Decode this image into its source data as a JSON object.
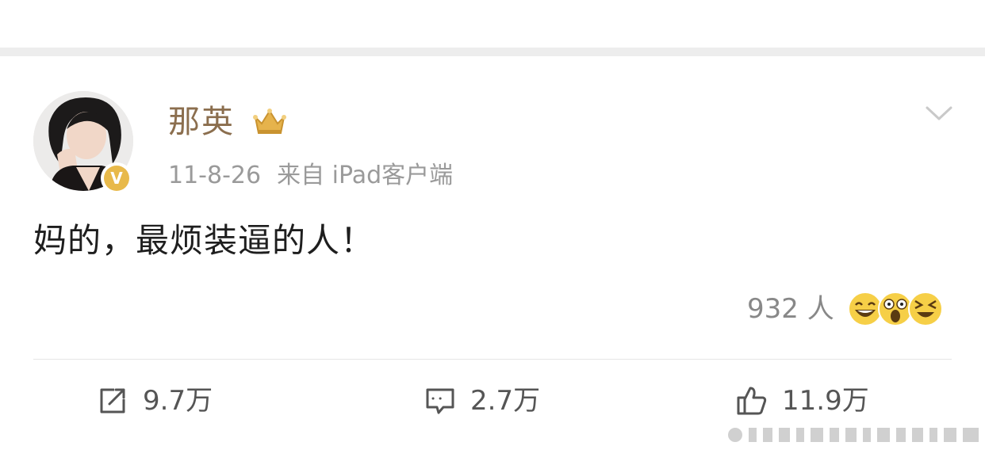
{
  "post": {
    "username": "那英",
    "date": "11-8-26",
    "source": "来自 iPad客户端",
    "text": "妈的，最烦装逼的人！",
    "reactions": {
      "count_label": "932 人",
      "emoji_icons": [
        "laughing-emoji-icon",
        "shocked-emoji-icon",
        "squinting-laugh-emoji-icon"
      ]
    },
    "actions": {
      "repost": {
        "icon": "repost-icon",
        "count": "9.7万"
      },
      "comment": {
        "icon": "comment-icon",
        "count": "2.7万"
      },
      "like": {
        "icon": "thumbs-up-icon",
        "count": "11.9万"
      }
    }
  },
  "colors": {
    "username": "#8b6e4e",
    "meta_text": "#9a9a9a",
    "separator": "#ededed",
    "verified_badge": "#e8b94a",
    "crown": "#e6b34c"
  }
}
